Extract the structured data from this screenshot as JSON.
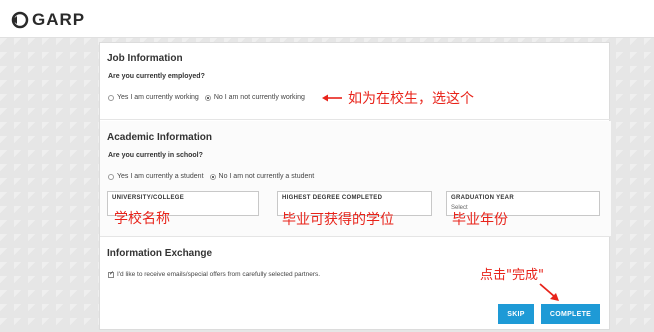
{
  "header": {
    "logo_text": "GARP"
  },
  "job": {
    "title": "Job Information",
    "question": "Are you currently employed?",
    "options": [
      "Yes I am currently working",
      "No I am not currently working"
    ],
    "selected_index": 1
  },
  "academic": {
    "title": "Academic Information",
    "question": "Are you currently in school?",
    "options": [
      "Yes I am currently a student",
      "No I am not currently a student"
    ],
    "selected_index": 1,
    "fields": [
      {
        "label": "UNIVERSITY/COLLEGE",
        "value": ""
      },
      {
        "label": "HIGHEST DEGREE COMPLETED",
        "value": ""
      },
      {
        "label": "GRADUATION YEAR",
        "value": "Select"
      }
    ]
  },
  "info_exchange": {
    "title": "Information Exchange",
    "checkbox_label": "I'd like to receive emails/special offers from carefully selected partners.",
    "checked": true
  },
  "buttons": {
    "skip": "SKIP",
    "complete": "COMPLETE"
  },
  "annotations": {
    "job_note": "如为在校生，选这个",
    "university_note": "学校名称",
    "degree_note": "毕业可获得的学位",
    "year_note": "毕业年份",
    "complete_note": "点击\"完成\""
  },
  "colors": {
    "button": "#1e9ad6",
    "annotation": "#e8231a"
  }
}
